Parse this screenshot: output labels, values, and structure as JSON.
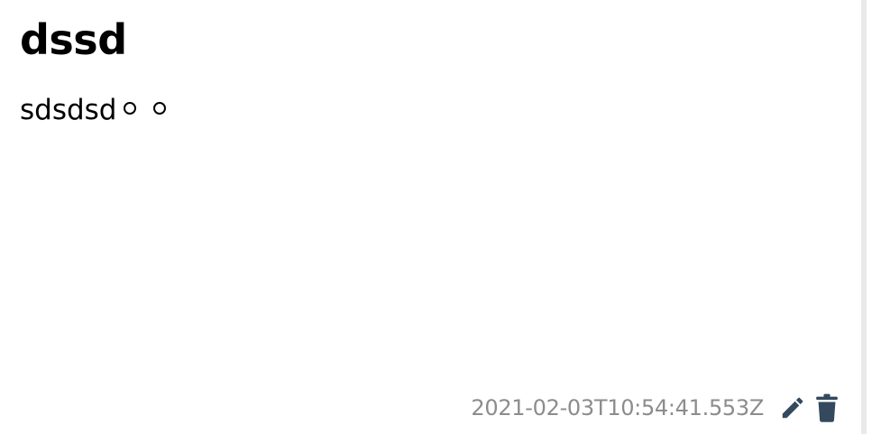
{
  "note": {
    "title": "dssd",
    "body": "sdsdsd",
    "timestamp": "2021-02-03T10:54:41.553Z"
  },
  "icons": {
    "body_decorations": [
      "circle-icon",
      "circle-icon"
    ],
    "edit": "pencil-icon",
    "delete": "trash-icon"
  },
  "colors": {
    "icon": "#34495e",
    "timestamp": "#8c8c8c",
    "text": "#000000"
  }
}
